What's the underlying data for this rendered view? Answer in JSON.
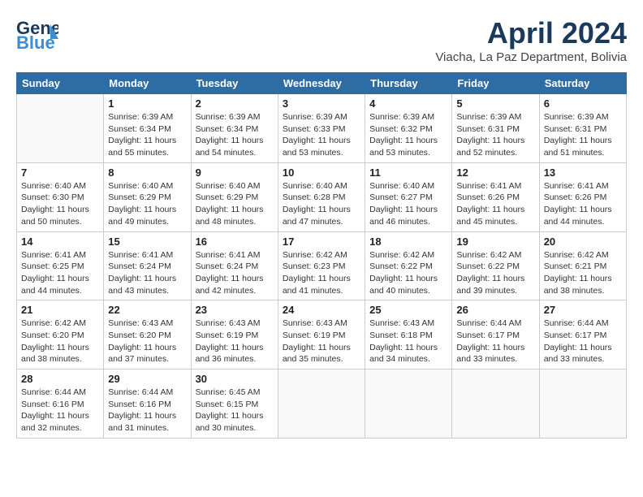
{
  "header": {
    "logo_line1": "General",
    "logo_line2": "Blue",
    "month": "April 2024",
    "location": "Viacha, La Paz Department, Bolivia"
  },
  "days_of_week": [
    "Sunday",
    "Monday",
    "Tuesday",
    "Wednesday",
    "Thursday",
    "Friday",
    "Saturday"
  ],
  "weeks": [
    [
      {
        "day": "",
        "info": ""
      },
      {
        "day": "1",
        "info": "Sunrise: 6:39 AM\nSunset: 6:34 PM\nDaylight: 11 hours\nand 55 minutes."
      },
      {
        "day": "2",
        "info": "Sunrise: 6:39 AM\nSunset: 6:34 PM\nDaylight: 11 hours\nand 54 minutes."
      },
      {
        "day": "3",
        "info": "Sunrise: 6:39 AM\nSunset: 6:33 PM\nDaylight: 11 hours\nand 53 minutes."
      },
      {
        "day": "4",
        "info": "Sunrise: 6:39 AM\nSunset: 6:32 PM\nDaylight: 11 hours\nand 53 minutes."
      },
      {
        "day": "5",
        "info": "Sunrise: 6:39 AM\nSunset: 6:31 PM\nDaylight: 11 hours\nand 52 minutes."
      },
      {
        "day": "6",
        "info": "Sunrise: 6:39 AM\nSunset: 6:31 PM\nDaylight: 11 hours\nand 51 minutes."
      }
    ],
    [
      {
        "day": "7",
        "info": "Sunrise: 6:40 AM\nSunset: 6:30 PM\nDaylight: 11 hours\nand 50 minutes."
      },
      {
        "day": "8",
        "info": "Sunrise: 6:40 AM\nSunset: 6:29 PM\nDaylight: 11 hours\nand 49 minutes."
      },
      {
        "day": "9",
        "info": "Sunrise: 6:40 AM\nSunset: 6:29 PM\nDaylight: 11 hours\nand 48 minutes."
      },
      {
        "day": "10",
        "info": "Sunrise: 6:40 AM\nSunset: 6:28 PM\nDaylight: 11 hours\nand 47 minutes."
      },
      {
        "day": "11",
        "info": "Sunrise: 6:40 AM\nSunset: 6:27 PM\nDaylight: 11 hours\nand 46 minutes."
      },
      {
        "day": "12",
        "info": "Sunrise: 6:41 AM\nSunset: 6:26 PM\nDaylight: 11 hours\nand 45 minutes."
      },
      {
        "day": "13",
        "info": "Sunrise: 6:41 AM\nSunset: 6:26 PM\nDaylight: 11 hours\nand 44 minutes."
      }
    ],
    [
      {
        "day": "14",
        "info": "Sunrise: 6:41 AM\nSunset: 6:25 PM\nDaylight: 11 hours\nand 44 minutes."
      },
      {
        "day": "15",
        "info": "Sunrise: 6:41 AM\nSunset: 6:24 PM\nDaylight: 11 hours\nand 43 minutes."
      },
      {
        "day": "16",
        "info": "Sunrise: 6:41 AM\nSunset: 6:24 PM\nDaylight: 11 hours\nand 42 minutes."
      },
      {
        "day": "17",
        "info": "Sunrise: 6:42 AM\nSunset: 6:23 PM\nDaylight: 11 hours\nand 41 minutes."
      },
      {
        "day": "18",
        "info": "Sunrise: 6:42 AM\nSunset: 6:22 PM\nDaylight: 11 hours\nand 40 minutes."
      },
      {
        "day": "19",
        "info": "Sunrise: 6:42 AM\nSunset: 6:22 PM\nDaylight: 11 hours\nand 39 minutes."
      },
      {
        "day": "20",
        "info": "Sunrise: 6:42 AM\nSunset: 6:21 PM\nDaylight: 11 hours\nand 38 minutes."
      }
    ],
    [
      {
        "day": "21",
        "info": "Sunrise: 6:42 AM\nSunset: 6:20 PM\nDaylight: 11 hours\nand 38 minutes."
      },
      {
        "day": "22",
        "info": "Sunrise: 6:43 AM\nSunset: 6:20 PM\nDaylight: 11 hours\nand 37 minutes."
      },
      {
        "day": "23",
        "info": "Sunrise: 6:43 AM\nSunset: 6:19 PM\nDaylight: 11 hours\nand 36 minutes."
      },
      {
        "day": "24",
        "info": "Sunrise: 6:43 AM\nSunset: 6:19 PM\nDaylight: 11 hours\nand 35 minutes."
      },
      {
        "day": "25",
        "info": "Sunrise: 6:43 AM\nSunset: 6:18 PM\nDaylight: 11 hours\nand 34 minutes."
      },
      {
        "day": "26",
        "info": "Sunrise: 6:44 AM\nSunset: 6:17 PM\nDaylight: 11 hours\nand 33 minutes."
      },
      {
        "day": "27",
        "info": "Sunrise: 6:44 AM\nSunset: 6:17 PM\nDaylight: 11 hours\nand 33 minutes."
      }
    ],
    [
      {
        "day": "28",
        "info": "Sunrise: 6:44 AM\nSunset: 6:16 PM\nDaylight: 11 hours\nand 32 minutes."
      },
      {
        "day": "29",
        "info": "Sunrise: 6:44 AM\nSunset: 6:16 PM\nDaylight: 11 hours\nand 31 minutes."
      },
      {
        "day": "30",
        "info": "Sunrise: 6:45 AM\nSunset: 6:15 PM\nDaylight: 11 hours\nand 30 minutes."
      },
      {
        "day": "",
        "info": ""
      },
      {
        "day": "",
        "info": ""
      },
      {
        "day": "",
        "info": ""
      },
      {
        "day": "",
        "info": ""
      }
    ]
  ]
}
